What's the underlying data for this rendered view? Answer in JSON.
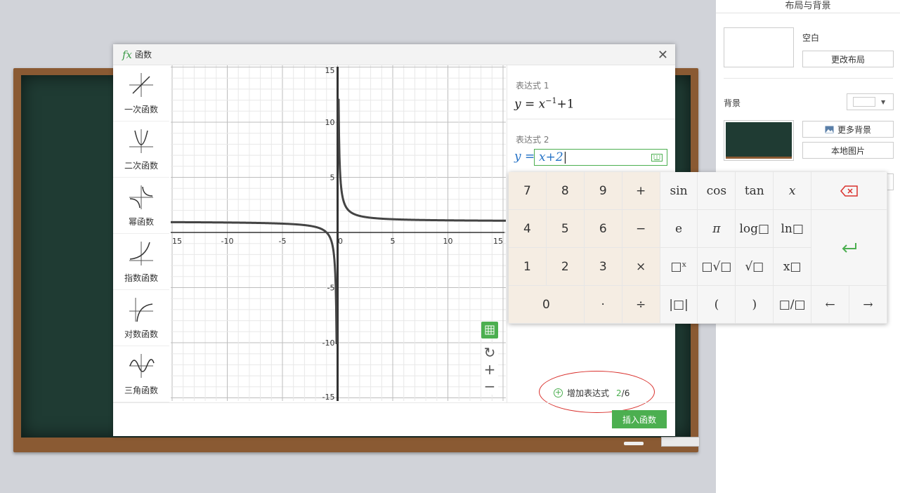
{
  "right_panel": {
    "title": "布局与背景",
    "layout_label": "空白",
    "change_layout": "更改布局",
    "background_label": "背景",
    "more_backgrounds": "更多背景",
    "local_image": "本地图片"
  },
  "dialog": {
    "title_icon": "fx",
    "title": "函数",
    "close_glyph": "✕",
    "function_types": [
      {
        "label": "一次函数",
        "icon": "linear-function-icon"
      },
      {
        "label": "二次函数",
        "icon": "quadratic-function-icon"
      },
      {
        "label": "幂函数",
        "icon": "power-function-icon"
      },
      {
        "label": "指数函数",
        "icon": "exponential-function-icon"
      },
      {
        "label": "对数函数",
        "icon": "logarithmic-function-icon"
      },
      {
        "label": "三角函数",
        "icon": "trigonometric-function-icon"
      }
    ],
    "expressions": [
      {
        "label": "表达式 1",
        "formula": "y = x^-1+1"
      },
      {
        "label": "表达式 2",
        "prefix": "y =",
        "value": "x+2"
      }
    ],
    "add_expression": "增加表达式",
    "expression_count": "2",
    "expression_max": "/6",
    "insert_button": "插入函数",
    "graph_tools": [
      "grid-toggle-icon",
      "reset-view-icon",
      "zoom-in-icon",
      "zoom-out-icon"
    ]
  },
  "graph": {
    "x_ticks": [
      "15",
      "-10",
      "-5",
      "0",
      "5",
      "10",
      "15"
    ],
    "y_ticks": [
      "15",
      "10",
      "5",
      "-5",
      "-10",
      "-15"
    ],
    "xlim": [
      -15,
      15
    ],
    "ylim": [
      -15,
      15
    ],
    "curve": "y = 1/x + 1",
    "grid": true
  },
  "keyboard": {
    "keys": [
      {
        "label": "7",
        "kind": "num"
      },
      {
        "label": "8",
        "kind": "num"
      },
      {
        "label": "9",
        "kind": "num"
      },
      {
        "label": "+",
        "kind": "num"
      },
      {
        "label": "sin",
        "kind": "fn"
      },
      {
        "label": "cos",
        "kind": "fn"
      },
      {
        "label": "tan",
        "kind": "fn"
      },
      {
        "label": "x",
        "kind": "fn"
      },
      {
        "label": "4",
        "kind": "num"
      },
      {
        "label": "5",
        "kind": "num"
      },
      {
        "label": "6",
        "kind": "num"
      },
      {
        "label": "−",
        "kind": "num"
      },
      {
        "label": "e",
        "kind": "fn"
      },
      {
        "label": "π",
        "kind": "fn"
      },
      {
        "label": "log□",
        "kind": "fn"
      },
      {
        "label": "ln□",
        "kind": "fn"
      },
      {
        "label": "1",
        "kind": "num"
      },
      {
        "label": "2",
        "kind": "num"
      },
      {
        "label": "3",
        "kind": "num"
      },
      {
        "label": "×",
        "kind": "num"
      },
      {
        "label": "□ˣ",
        "kind": "fn"
      },
      {
        "label": "□√□",
        "kind": "fn"
      },
      {
        "label": "√□",
        "kind": "fn"
      },
      {
        "label": "x□",
        "kind": "fn"
      },
      {
        "label": "0",
        "kind": "num"
      },
      {
        "label": "·",
        "kind": "num"
      },
      {
        "label": "÷",
        "kind": "num"
      },
      {
        "label": "|□|",
        "kind": "fn"
      },
      {
        "label": "(",
        "kind": "fn"
      },
      {
        "label": ")",
        "kind": "fn"
      },
      {
        "label": "□/□",
        "kind": "fn"
      },
      {
        "label": "←",
        "kind": "fn"
      },
      {
        "label": "→",
        "kind": "fn"
      }
    ]
  }
}
